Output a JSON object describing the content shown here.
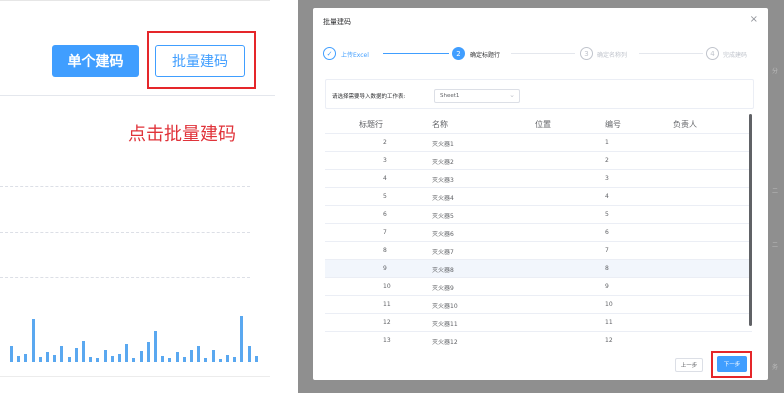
{
  "left_panel": {
    "single_code_button": "单个建码",
    "batch_code_button": "批量建码",
    "annotation": "点击批量建码",
    "mini_chart_bar_levels": [
      0.3,
      0.12,
      0.16,
      0.82,
      0.1,
      0.2,
      0.14,
      0.3,
      0.09,
      0.26,
      0.4,
      0.1,
      0.07,
      0.23,
      0.12,
      0.16,
      0.34,
      0.08,
      0.21,
      0.38,
      0.6,
      0.11,
      0.07,
      0.2,
      0.1,
      0.23,
      0.3,
      0.08,
      0.24,
      0.06,
      0.14,
      0.1,
      0.88,
      0.3,
      0.12
    ]
  },
  "dialog": {
    "title": "批量建码",
    "close_icon": "×",
    "steps": [
      {
        "number": "✓",
        "label": "上传Excel",
        "state": "done"
      },
      {
        "number": "2",
        "label": "确定标题行",
        "state": "active"
      },
      {
        "number": "3",
        "label": "确定名称列",
        "state": "pending"
      },
      {
        "number": "4",
        "label": "完成建码",
        "state": "pending"
      }
    ],
    "sheet_label": "请选择需要导入数据的工作表:",
    "sheet_value": "Sheet1",
    "table": {
      "headers": [
        "标题行",
        "名称",
        "位置",
        "编号",
        "负责人"
      ],
      "rows": [
        [
          "2",
          "灭火器1",
          "",
          "1",
          ""
        ],
        [
          "3",
          "灭火器2",
          "",
          "2",
          ""
        ],
        [
          "4",
          "灭火器3",
          "",
          "3",
          ""
        ],
        [
          "5",
          "灭火器4",
          "",
          "4",
          ""
        ],
        [
          "6",
          "灭火器5",
          "",
          "5",
          ""
        ],
        [
          "7",
          "灭火器6",
          "",
          "6",
          ""
        ],
        [
          "8",
          "灭火器7",
          "",
          "7",
          ""
        ],
        [
          "9",
          "灭火器8",
          "",
          "8",
          ""
        ],
        [
          "10",
          "灭火器9",
          "",
          "9",
          ""
        ],
        [
          "11",
          "灭火器10",
          "",
          "10",
          ""
        ],
        [
          "12",
          "灭火器11",
          "",
          "11",
          ""
        ],
        [
          "13",
          "灭火器12",
          "",
          "12",
          ""
        ]
      ],
      "highlighted_row": 7
    },
    "prev_button": "上一步",
    "next_button": "下一步"
  },
  "background_text": [
    "分",
    "二",
    "二",
    "务"
  ],
  "colors": {
    "primary": "#409eff",
    "highlight_red": "#e5262a",
    "annotation_red": "#e0333a",
    "overlay": "#8f8f8f"
  }
}
